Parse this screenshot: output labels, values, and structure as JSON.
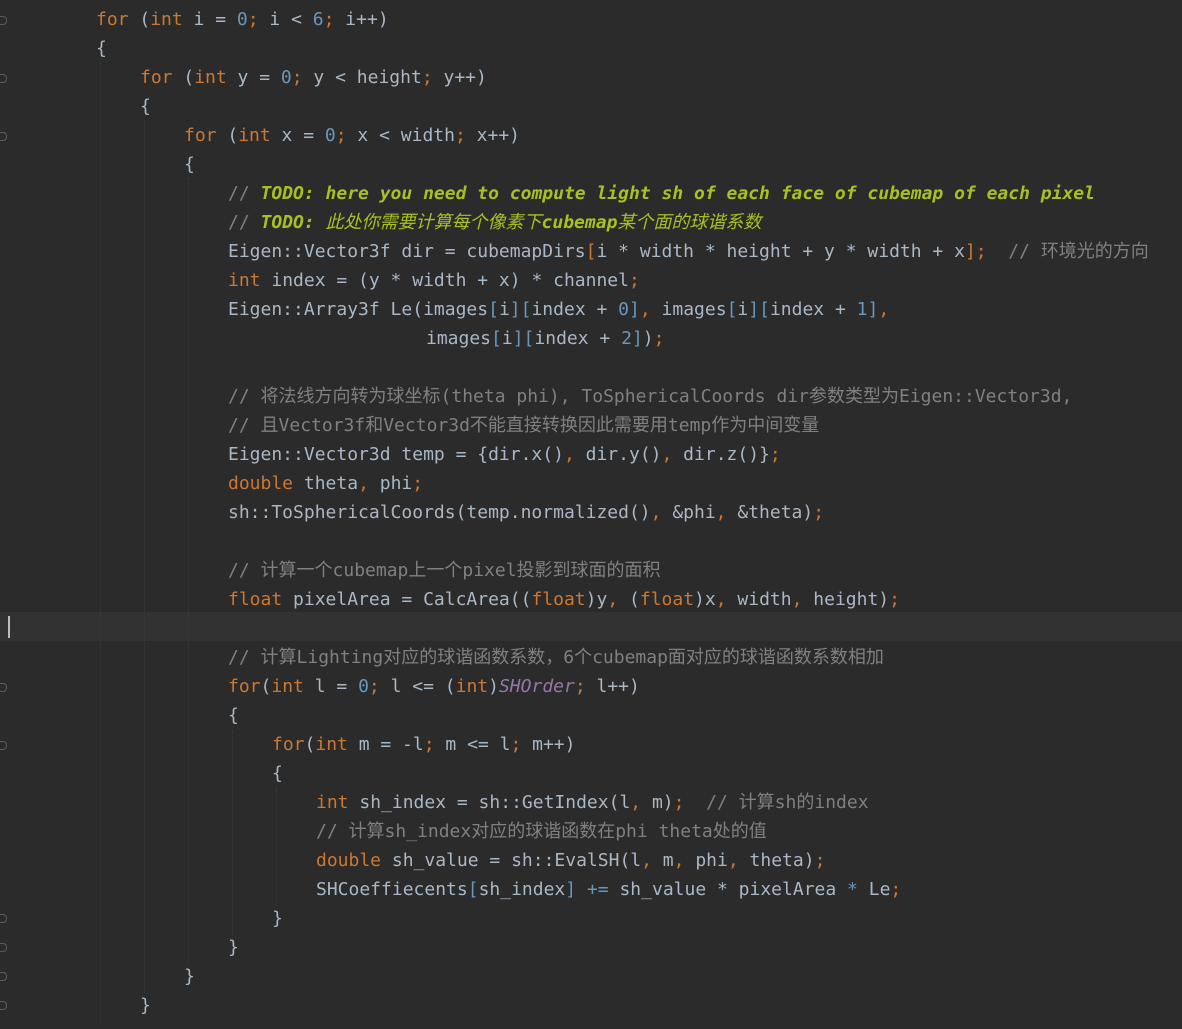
{
  "colors": {
    "background": "#2b2b2b",
    "keyword": "#cc7832",
    "number": "#6897bb",
    "comment": "#808080",
    "todo": "#a8c023",
    "constant": "#9876aa",
    "text": "#a9b7c6"
  },
  "code": {
    "l1": {
      "a": "for",
      "b": " (",
      "c": "int",
      "d": " i = ",
      "e": "0",
      "f": ";",
      "g": " i < ",
      "h": "6",
      "i": ";",
      "j": " i++)"
    },
    "l2": {
      "a": "{"
    },
    "l3": {
      "a": "for",
      "b": " (",
      "c": "int",
      "d": " y = ",
      "e": "0",
      "f": ";",
      "g": " y < height",
      "h": ";",
      "i": " y++)"
    },
    "l4": {
      "a": "{"
    },
    "l5": {
      "a": "for",
      "b": " (",
      "c": "int",
      "d": " x = ",
      "e": "0",
      "f": ";",
      "g": " x < width",
      "h": ";",
      "i": " x++)"
    },
    "l6": {
      "a": "{"
    },
    "l7": {
      "a": "// ",
      "b": "TODO: here you need to compute light sh of each face of cubemap of each pixel"
    },
    "l8": {
      "a": "// ",
      "b": "TODO: ",
      "c": "此处你需要计算每个像素下",
      "d": "cubemap",
      "e": "某个面的球谐系数"
    },
    "l9": {
      "a": "Eigen::Vector3f dir = cubemapDirs",
      "b": "[",
      "c": "i * width * height + y * width + x",
      "d": "]",
      "e": ";",
      "f": "  // ",
      "g": "环境光的方向"
    },
    "l10": {
      "a": "int",
      "b": " index = (y * width + x) * channel",
      "c": ";"
    },
    "l11": {
      "a": "Eigen::Array3f Le(images",
      "b": "[",
      "c": "i",
      "d": "][",
      "e": "index + ",
      "f": "0",
      "g": "]",
      "h": ",",
      "i": " images",
      "j": "[",
      "k": "i",
      "l": "][",
      "m": "index + ",
      "n": "1",
      "o": "]",
      "p": ","
    },
    "l12": {
      "a": "images",
      "b": "[",
      "c": "i",
      "d": "][",
      "e": "index + ",
      "f": "2",
      "g": "]",
      "h": ")",
      "i": ";"
    },
    "l13": {
      "a": "// ",
      "b": "将法线方向转为球坐标",
      "c": "(theta phi), ToSphericalCoords dir",
      "d": "参数类型为",
      "e": "Eigen::Vector3d,"
    },
    "l14": {
      "a": "// ",
      "b": "且",
      "c": "Vector3f",
      "d": "和",
      "e": "Vector3d",
      "f": "不能直接转换因此需要用",
      "g": "temp",
      "h": "作为中间变量"
    },
    "l15": {
      "a": "Eigen::Vector3d temp = {dir.x()",
      "b": ",",
      "c": " dir.y()",
      "d": ",",
      "e": " dir.z()}",
      "f": ";"
    },
    "l16": {
      "a": "double",
      "b": " theta",
      "c": ",",
      "d": " phi",
      "e": ";"
    },
    "l17": {
      "a": "sh::ToSphericalCoords(temp.normalized()",
      "b": ",",
      "c": " &phi",
      "d": ",",
      "e": " &theta)",
      "f": ";"
    },
    "l18": {
      "a": "// ",
      "b": "计算一个",
      "c": "cubemap",
      "d": "上一个",
      "e": "pixel",
      "f": "投影到球面的面积"
    },
    "l19": {
      "a": "float",
      "b": " pixelArea = CalcArea((",
      "c": "float",
      "d": ")y",
      "e": ",",
      "f": " (",
      "g": "float",
      "h": ")x",
      "i": ",",
      "j": " width",
      "k": ",",
      "l": " height)",
      "m": ";"
    },
    "l20": {
      "a": "// ",
      "b": "计算",
      "c": "Lighting",
      "d": "对应的球谐函数系数，",
      "e": "6",
      "f": "个",
      "g": "cubemap",
      "h": "面对应的球谐函数系数相加"
    },
    "l21": {
      "a": "for",
      "b": "(",
      "c": "int",
      "d": " l = ",
      "e": "0",
      "f": ";",
      "g": " l <= (",
      "h": "int",
      "i": ")",
      "j": "SHOrder",
      "k": ";",
      "l": " l++)"
    },
    "l22": {
      "a": "{"
    },
    "l23": {
      "a": "for",
      "b": "(",
      "c": "int",
      "d": " m = -l",
      "e": ";",
      "f": " m <= l",
      "g": ";",
      "h": " m++)"
    },
    "l24": {
      "a": "{"
    },
    "l25": {
      "a": "int",
      "b": " sh_index = sh::GetIndex(l",
      "c": ",",
      "d": " m)",
      "e": ";",
      "f": "  // ",
      "g": "计算",
      "h": "sh",
      "i": "的",
      "j": "index"
    },
    "l26": {
      "a": "// ",
      "b": "计算",
      "c": "sh_index",
      "d": "对应的球谐函数在",
      "e": "phi theta",
      "f": "处的值"
    },
    "l27": {
      "a": "double",
      "b": " sh_value = sh::EvalSH(l",
      "c": ",",
      "d": " m",
      "e": ",",
      "f": " phi",
      "g": ",",
      "h": " theta)",
      "i": ";"
    },
    "l28": {
      "a": "SHCoeffiecents",
      "b": "[",
      "c": "sh_index",
      "d": "]",
      "e": " += ",
      "f": "sh_value * pixelArea ",
      "g": "*",
      "h": " Le",
      "i": ";"
    },
    "l29": {
      "a": "}"
    },
    "l30": {
      "a": "}"
    },
    "l31": {
      "a": "}"
    },
    "l32": {
      "a": "}"
    }
  }
}
